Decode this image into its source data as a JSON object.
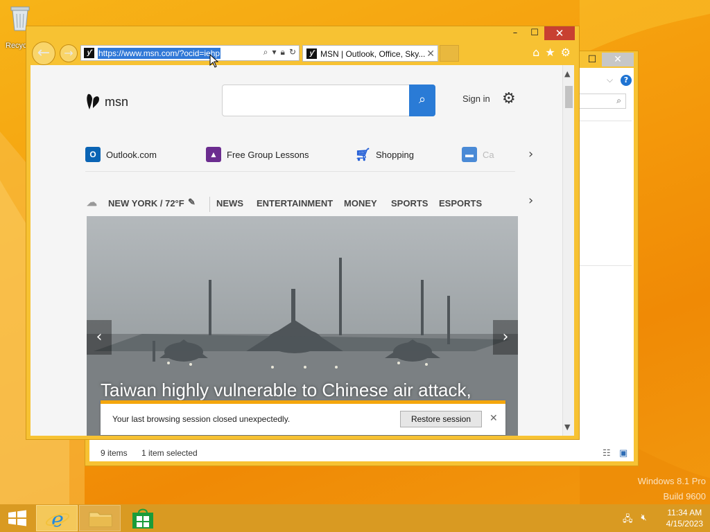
{
  "desktop": {
    "recycle_bin_label": "Recycle Bin",
    "watermark_line1": "Windows 8.1 Pro",
    "watermark_line2": "Build 9600"
  },
  "explorer": {
    "status_items": "9 items",
    "status_selected": "1 item selected",
    "help_label": "?"
  },
  "ie": {
    "url": "https://www.msn.com/?ocid=iehp",
    "tab_title": "MSN | Outlook, Office, Sky...",
    "msn": {
      "logo_text": "msn",
      "search_placeholder": "",
      "signin": "Sign in",
      "quick_links": [
        {
          "label": "Outlook.com",
          "icon": "outlook-icon",
          "color": "#0a64b4"
        },
        {
          "label": "Free Group Lessons",
          "icon": "graduation-cap-icon",
          "color": "#6b2c8f"
        },
        {
          "label": "Shopping",
          "icon": "shopping-cart-icon",
          "color": "#1e5bd6"
        },
        {
          "label": "Ca",
          "icon": "car-icon",
          "color": "#4a8ad6"
        }
      ],
      "weather": "NEW YORK / 72°F",
      "nav": [
        "NEWS",
        "ENTERTAINMENT",
        "MONEY",
        "SPORTS",
        "ESPORTS"
      ],
      "hero_headline": "Taiwan highly vulnerable to Chinese air attack,",
      "notification": {
        "message": "Your last browsing session closed unexpectedly.",
        "button": "Restore session"
      }
    }
  },
  "taskbar": {
    "time": "11:34 AM",
    "date": "4/15/2023"
  },
  "colors": {
    "window_frame": "#f7c233",
    "close_button": "#c84031",
    "search_button": "#2a7bd6",
    "notification_accent": "#f4a60c"
  }
}
